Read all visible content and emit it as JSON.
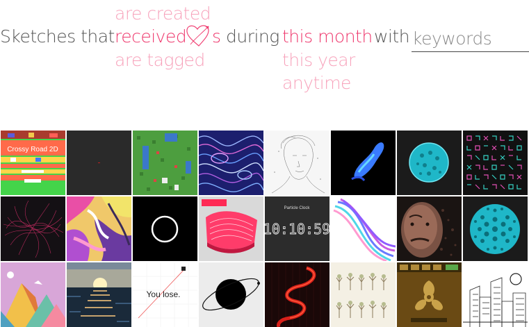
{
  "header": {
    "prefix": "Sketches that",
    "action_options": [
      {
        "label": "are created",
        "selected": false
      },
      {
        "label": "received",
        "selected": true
      },
      {
        "label": "are tagged",
        "selected": false
      }
    ],
    "heart_suffix": "s",
    "during": "during",
    "period_options": [
      {
        "label": "this month",
        "selected": true
      },
      {
        "label": "this year",
        "selected": false
      },
      {
        "label": "anytime",
        "selected": false
      }
    ],
    "with": "with",
    "keywords_placeholder": "keywords",
    "keywords_value": ""
  },
  "colors": {
    "accent": "#ed225d",
    "text": "#555555"
  },
  "sketches": {
    "thumbnail_texts": {
      "crossy_title": "Crossy Road 2D",
      "clock_label": "Particle Clock",
      "clock_time": "10:10:59",
      "game_over": "You lose."
    },
    "items": [
      {
        "icon": "crossy-road-thumbnail"
      },
      {
        "icon": "dark-blank-thumbnail"
      },
      {
        "icon": "grass-map-game-thumbnail"
      },
      {
        "icon": "blue-flow-lines-thumbnail"
      },
      {
        "icon": "sketched-portrait-thumbnail"
      },
      {
        "icon": "blue-cube-wave-thumbnail"
      },
      {
        "icon": "cyan-cell-circle-thumbnail"
      },
      {
        "icon": "glyph-grid-thumbnail"
      },
      {
        "icon": "pink-string-circle-thumbnail"
      },
      {
        "icon": "paint-swirl-thumbnail"
      },
      {
        "icon": "white-ring-thumbnail"
      },
      {
        "icon": "pink-wave-surface-thumbnail"
      },
      {
        "icon": "particle-clock-thumbnail"
      },
      {
        "icon": "ribbon-swirl-thumbnail"
      },
      {
        "icon": "particle-portrait-thumbnail"
      },
      {
        "icon": "cyan-dot-circle-thumbnail"
      },
      {
        "icon": "low-poly-mountains-thumbnail"
      },
      {
        "icon": "ocean-sunset-thumbnail"
      },
      {
        "icon": "you-lose-game-thumbnail"
      },
      {
        "icon": "planet-ring-thumbnail"
      },
      {
        "icon": "red-squiggle-thumbnail"
      },
      {
        "icon": "tree-sketches-thumbnail"
      },
      {
        "icon": "biohazard-ui-thumbnail"
      },
      {
        "icon": "city-buildings-thumbnail"
      }
    ]
  }
}
